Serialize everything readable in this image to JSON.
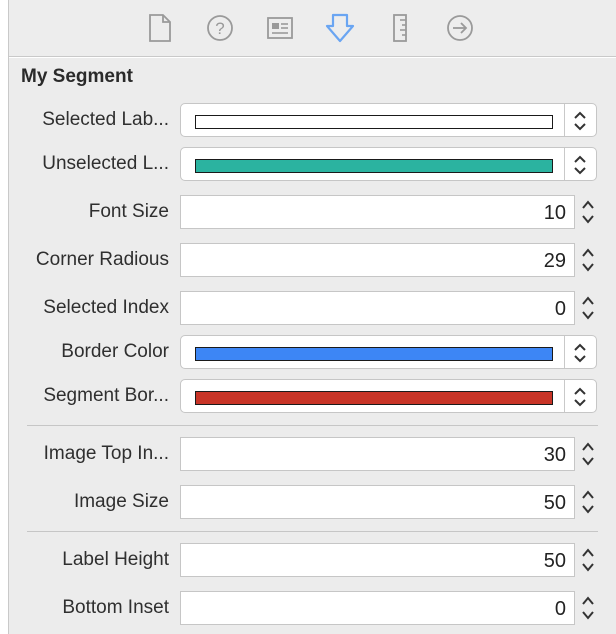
{
  "toolbar": {
    "icons": [
      {
        "name": "file-inspector-icon"
      },
      {
        "name": "quick-help-icon"
      },
      {
        "name": "identity-inspector-icon"
      },
      {
        "name": "attributes-inspector-icon"
      },
      {
        "name": "size-inspector-icon"
      },
      {
        "name": "connections-inspector-icon"
      }
    ],
    "active_color": "#6aa5f2",
    "inactive_color": "#9a9a9a"
  },
  "section": {
    "title": "My Segment"
  },
  "fields": {
    "selected_label_color": {
      "label": "Selected Lab...",
      "color": "#ffffff"
    },
    "unselected_label_color": {
      "label": "Unselected L...",
      "color": "#2bb3a0"
    },
    "font_size": {
      "label": "Font Size",
      "value": "10"
    },
    "corner_radius": {
      "label": "Corner Radious",
      "value": "29"
    },
    "selected_index": {
      "label": "Selected Index",
      "value": "0"
    },
    "border_color": {
      "label": "Border Color",
      "color": "#3d86f5"
    },
    "segment_border_color": {
      "label": "Segment Bor...",
      "color": "#c83427"
    },
    "image_top_inset": {
      "label": "Image Top In...",
      "value": "30"
    },
    "image_size": {
      "label": "Image Size",
      "value": "50"
    },
    "label_height": {
      "label": "Label Height",
      "value": "50"
    },
    "bottom_inset": {
      "label": "Bottom Inset",
      "value": "0"
    }
  }
}
